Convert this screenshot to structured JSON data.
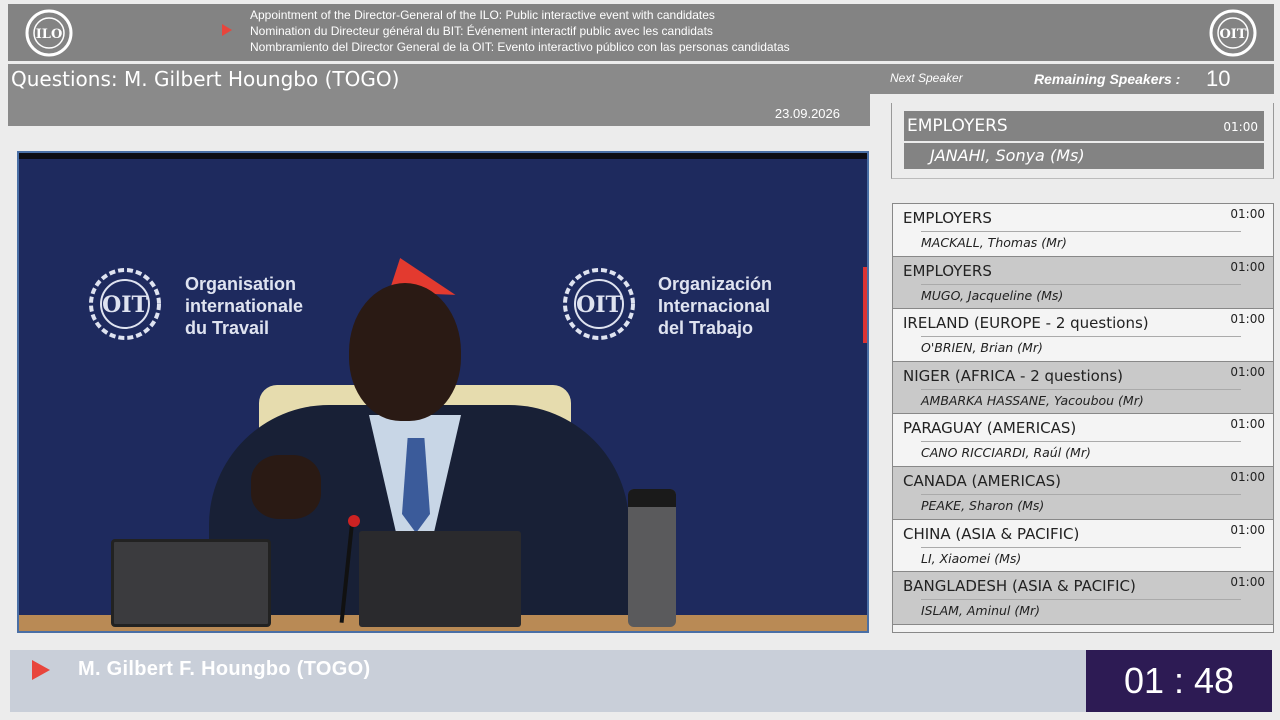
{
  "banner": {
    "lines": [
      "Appointment of the Director-General of the ILO: Public interactive event with candidates",
      "Nomination du Directeur général du BIT: Événement interactif public avec les candidats",
      "Nombramiento del Director General de la OIT: Evento interactivo público con las personas candidatas"
    ],
    "logo_left_icon": "ilo-emblem-icon",
    "logo_right_icon": "oit-emblem-icon"
  },
  "titlebar": {
    "title": "Questions: M. Gilbert Houngbo (TOGO)",
    "date": "23.09.2026"
  },
  "header": {
    "next_label": "Next Speaker",
    "remaining_label": "Remaining Speakers :",
    "remaining_count": "10"
  },
  "next_speaker": {
    "group": "EMPLOYERS",
    "time": "01:00",
    "name": "JANAHI, Sonya (Ms)"
  },
  "video": {
    "org_fr": [
      "Organisation",
      "internationale",
      "du Travail"
    ],
    "org_es": [
      "Organización",
      "Internacional",
      "del Trabajo"
    ]
  },
  "speakers": [
    {
      "group": "EMPLOYERS",
      "name": "MACKALL, Thomas (Mr)",
      "time": "01:00"
    },
    {
      "group": "EMPLOYERS",
      "name": "MUGO, Jacqueline (Ms)",
      "time": "01:00"
    },
    {
      "group": "IRELAND  (EUROPE - 2 questions)",
      "name": "O'BRIEN, Brian (Mr)",
      "time": "01:00"
    },
    {
      "group": "NIGER  (AFRICA - 2 questions)",
      "name": "AMBARKA HASSANE, Yacoubou (Mr)",
      "time": "01:00"
    },
    {
      "group": "PARAGUAY  (AMERICAS)",
      "name": "CANO RICCIARDI, Raúl (Mr)",
      "time": "01:00"
    },
    {
      "group": "CANADA  (AMERICAS)",
      "name": "PEAKE, Sharon (Ms)",
      "time": "01:00"
    },
    {
      "group": "CHINA  (ASIA & PACIFIC)",
      "name": "LI, Xiaomei (Ms)",
      "time": "01:00"
    },
    {
      "group": "BANGLADESH  (ASIA & PACIFIC)",
      "name": "ISLAM, Aminul (Mr)",
      "time": "01:00"
    }
  ],
  "bottom": {
    "speaker": "M. Gilbert F. Houngbo  (TOGO)",
    "timer": "01 : 48"
  },
  "colors": {
    "accent_red": "#e8453c",
    "timer_bg": "#2d1b54",
    "banner_gray": "#838383",
    "video_bg": "#1e2a5e"
  }
}
